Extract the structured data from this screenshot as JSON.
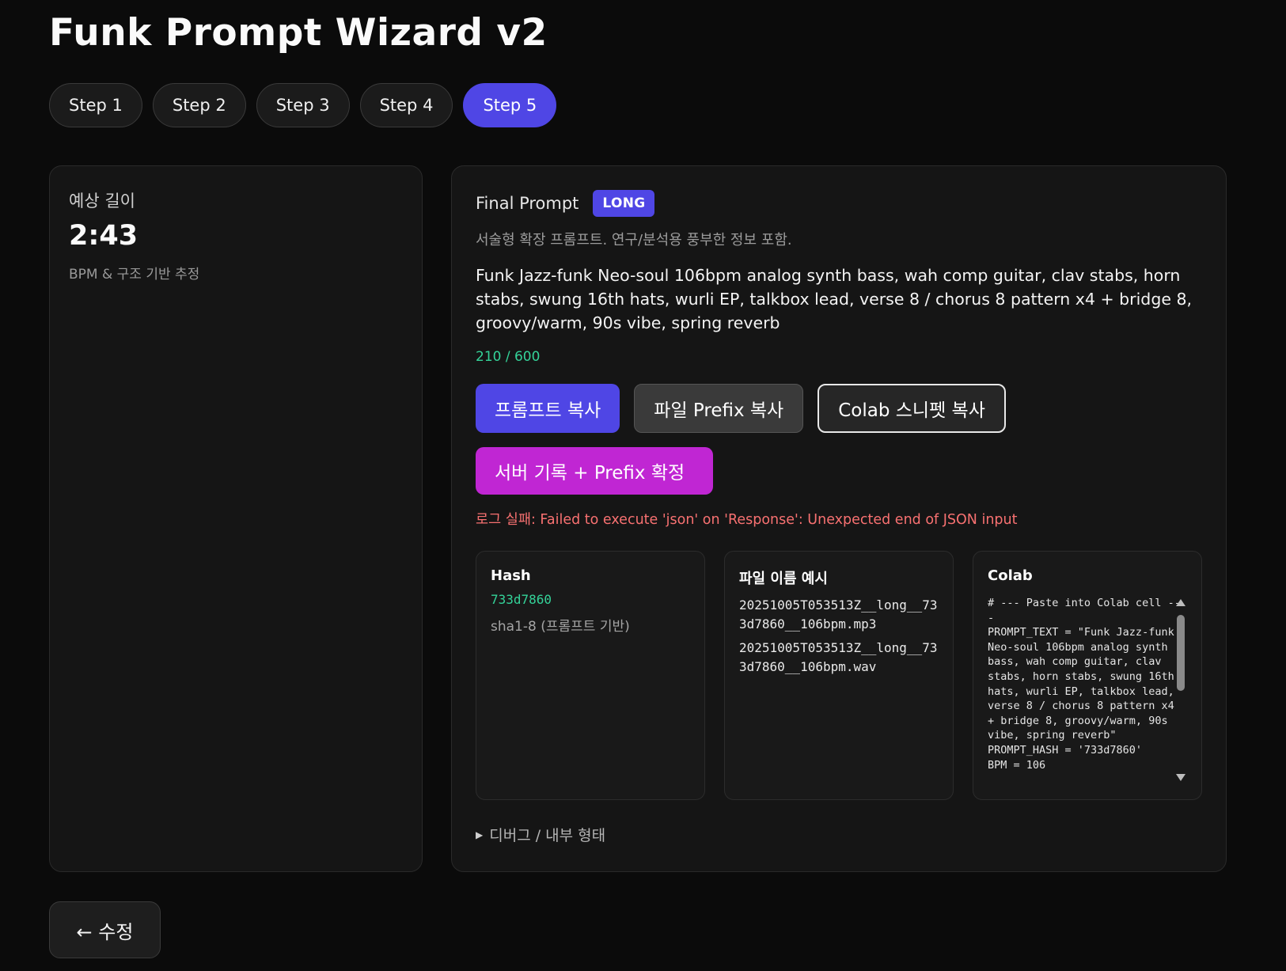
{
  "app": {
    "title": "Funk Prompt Wizard v2"
  },
  "steps": [
    {
      "label": "Step 1",
      "active": false
    },
    {
      "label": "Step 2",
      "active": false
    },
    {
      "label": "Step 3",
      "active": false
    },
    {
      "label": "Step 4",
      "active": false
    },
    {
      "label": "Step 5",
      "active": true
    }
  ],
  "estimate": {
    "label": "예상 길이",
    "value": "2:43",
    "note": "BPM & 구조 기반 추정"
  },
  "final_prompt": {
    "title": "Final Prompt",
    "badge": "LONG",
    "subtitle": "서술형 확장 프롬프트. 연구/분석용 풍부한 정보 포함.",
    "text": "Funk Jazz-funk Neo-soul 106bpm analog synth bass, wah comp guitar, clav stabs, horn stabs, swung 16th hats, wurli EP, talkbox lead, verse 8 / chorus 8 pattern x4 + bridge 8, groovy/warm, 90s vibe, spring reverb",
    "char_count": "210 / 600"
  },
  "buttons": {
    "copy_prompt": "프롬프트 복사",
    "copy_prefix": "파일 Prefix 복사",
    "copy_colab": "Colab 스니펫 복사",
    "server_log": "서버 기록 + Prefix 확정"
  },
  "error": {
    "message": "로그 실패: Failed to execute 'json' on 'Response': Unexpected end of JSON input"
  },
  "hash_box": {
    "title": "Hash",
    "value": "733d7860",
    "note": "sha1-8 (프롬프트 기반)"
  },
  "filename_box": {
    "title": "파일 이름 예시",
    "files": [
      "20251005T053513Z__long__733d7860__106bpm.mp3",
      "20251005T053513Z__long__733d7860__106bpm.wav"
    ]
  },
  "colab_box": {
    "title": "Colab",
    "code": "# --- Paste into Colab cell ---\nPROMPT_TEXT = \"Funk Jazz-funk Neo-soul 106bpm analog synth bass, wah comp guitar, clav stabs, horn stabs, swung 16th hats, wurli EP, talkbox lead, verse 8 / chorus 8 pattern x4 + bridge 8, groovy/warm, 90s vibe, spring reverb\"\nPROMPT_HASH = '733d7860'\nBPM = 106"
  },
  "debug": {
    "label": "디버그 / 내부 형태"
  },
  "back_button": {
    "label": "← 수정"
  },
  "colors": {
    "background": "#0b0b0b",
    "accent": "#4f46e5",
    "magenta": "#c026d3",
    "success": "#34d399",
    "error": "#f87171"
  }
}
